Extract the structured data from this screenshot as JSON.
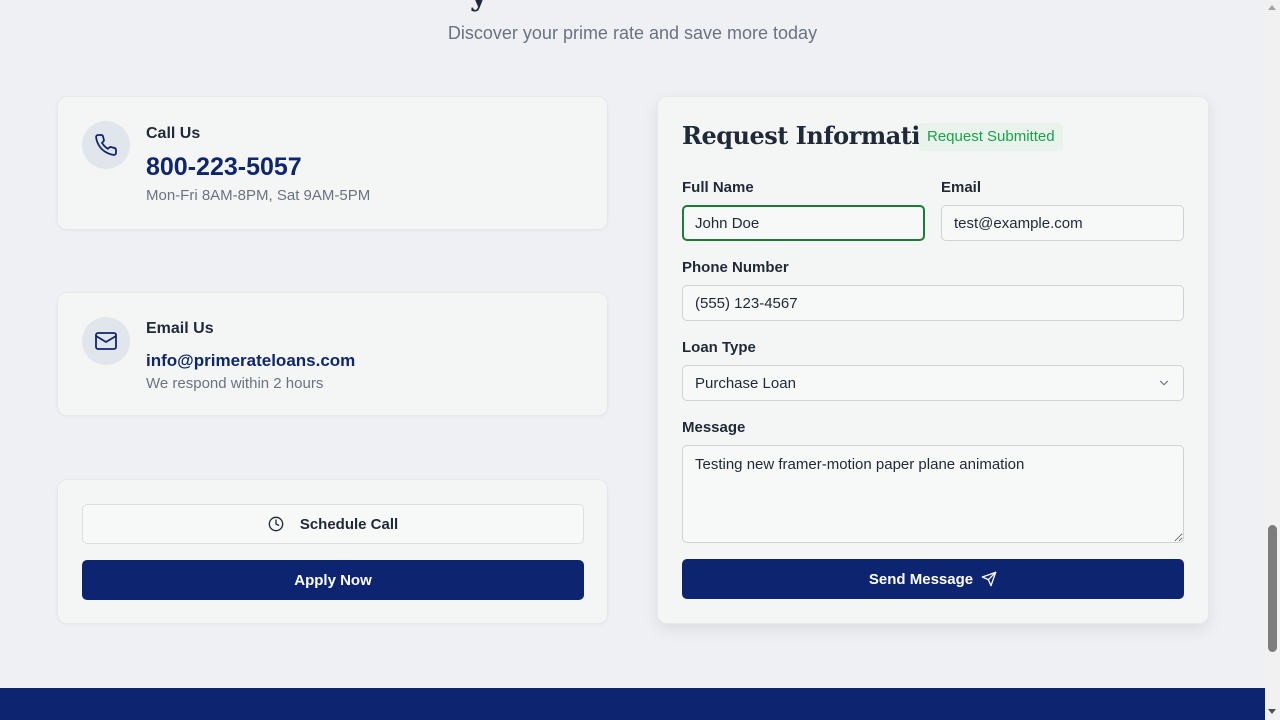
{
  "section": {
    "heading_fragment": "y",
    "subtitle": "Discover your prime rate and save more today"
  },
  "contact": {
    "call": {
      "title": "Call Us",
      "phone": "800-223-5057",
      "hours": "Mon-Fri 8AM-8PM, Sat 9AM-5PM",
      "icon": "phone-icon"
    },
    "email": {
      "title": "Email Us",
      "address": "info@primerateloans.com",
      "note": "We respond within 2 hours",
      "icon": "mail-icon"
    }
  },
  "actions": {
    "schedule_label": "Schedule Call",
    "apply_label": "Apply Now"
  },
  "form": {
    "title": "Request Information",
    "status_badge": "Request Submitted",
    "full_name": {
      "label": "Full Name",
      "value": "John Doe"
    },
    "email": {
      "label": "Email",
      "value": "test@example.com"
    },
    "phone": {
      "label": "Phone Number",
      "value": "(555) 123-4567"
    },
    "loan_type": {
      "label": "Loan Type",
      "value": "Purchase Loan"
    },
    "message": {
      "label": "Message",
      "value": "Testing new framer-motion paper plane animation"
    },
    "submit_label": "Send Message"
  },
  "colors": {
    "brand_navy": "#0d2570",
    "success_green": "#16a34a",
    "focus_border": "#1f7a3a"
  }
}
